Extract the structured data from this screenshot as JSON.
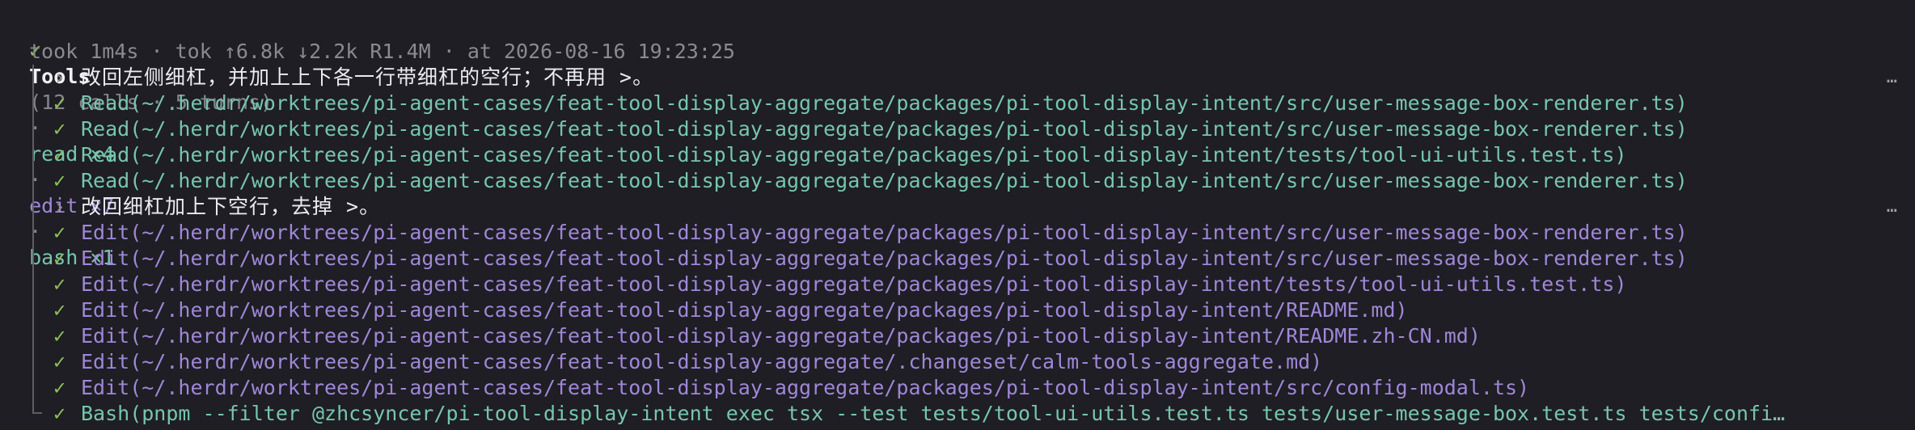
{
  "summary": {
    "check": "✓",
    "title": "Tools",
    "stats": "(12 calls · 5 turns)",
    "sep": "·",
    "read": "read ×4",
    "edit": "edit ×7",
    "bash": "bash ×1"
  },
  "meta": "took 1m4s · tok ↑6.8k ↓2.2k R1.4M · at 2026-08-16 19:23:25",
  "ellipsis": "…",
  "rows": [
    {
      "kind": "prompt",
      "marker": "›",
      "text": "改回左侧细杠，并加上上下各一行带细杠的空行；不再用 >。"
    },
    {
      "kind": "read",
      "marker": "✓",
      "text": "Read(~/.herdr/worktrees/pi-agent-cases/feat-tool-display-aggregate/packages/pi-tool-display-intent/src/user-message-box-renderer.ts)"
    },
    {
      "kind": "read",
      "marker": "✓",
      "text": "Read(~/.herdr/worktrees/pi-agent-cases/feat-tool-display-aggregate/packages/pi-tool-display-intent/src/user-message-box-renderer.ts)"
    },
    {
      "kind": "read",
      "marker": "✓",
      "text": "Read(~/.herdr/worktrees/pi-agent-cases/feat-tool-display-aggregate/packages/pi-tool-display-intent/tests/tool-ui-utils.test.ts)"
    },
    {
      "kind": "read",
      "marker": "✓",
      "text": "Read(~/.herdr/worktrees/pi-agent-cases/feat-tool-display-aggregate/packages/pi-tool-display-intent/src/user-message-box-renderer.ts)"
    },
    {
      "kind": "prompt",
      "marker": "›",
      "text": "改回细杠加上下空行，去掉 >。"
    },
    {
      "kind": "edit",
      "marker": "✓",
      "text": "Edit(~/.herdr/worktrees/pi-agent-cases/feat-tool-display-aggregate/packages/pi-tool-display-intent/src/user-message-box-renderer.ts)"
    },
    {
      "kind": "edit",
      "marker": "✓",
      "text": "Edit(~/.herdr/worktrees/pi-agent-cases/feat-tool-display-aggregate/packages/pi-tool-display-intent/src/user-message-box-renderer.ts)"
    },
    {
      "kind": "edit",
      "marker": "✓",
      "text": "Edit(~/.herdr/worktrees/pi-agent-cases/feat-tool-display-aggregate/packages/pi-tool-display-intent/tests/tool-ui-utils.test.ts)"
    },
    {
      "kind": "edit",
      "marker": "✓",
      "text": "Edit(~/.herdr/worktrees/pi-agent-cases/feat-tool-display-aggregate/packages/pi-tool-display-intent/README.md)"
    },
    {
      "kind": "edit",
      "marker": "✓",
      "text": "Edit(~/.herdr/worktrees/pi-agent-cases/feat-tool-display-aggregate/packages/pi-tool-display-intent/README.zh-CN.md)"
    },
    {
      "kind": "edit",
      "marker": "✓",
      "text": "Edit(~/.herdr/worktrees/pi-agent-cases/feat-tool-display-aggregate/.changeset/calm-tools-aggregate.md)"
    },
    {
      "kind": "edit",
      "marker": "✓",
      "text": "Edit(~/.herdr/worktrees/pi-agent-cases/feat-tool-display-aggregate/packages/pi-tool-display-intent/src/config-modal.ts)"
    },
    {
      "kind": "bash",
      "marker": "✓",
      "text": "Bash(pnpm --filter @zhcsyncer/pi-tool-display-intent exec tsx --test tests/tool-ui-utils.test.ts tests/user-message-box.test.ts tests/confi…"
    }
  ]
}
